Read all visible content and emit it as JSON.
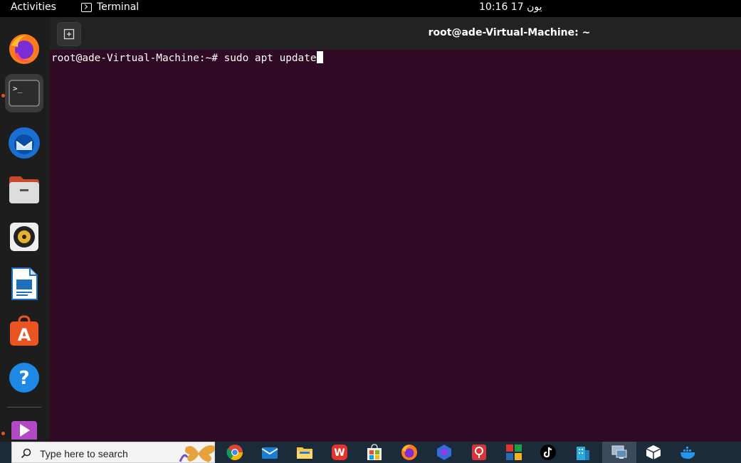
{
  "topbar": {
    "activities": "Activities",
    "app_name": "Terminal",
    "clock": "10:16  يون 17"
  },
  "dock": {
    "items": [
      "firefox-icon",
      "terminal-icon",
      "thunderbird-icon",
      "files-icon",
      "rhythmbox-icon",
      "libreoffice-writer-icon",
      "ubuntu-software-icon",
      "help-icon",
      "media-player-icon"
    ],
    "active": "terminal-icon"
  },
  "terminal": {
    "title": "root@ade-Virtual-Machine: ~",
    "prompt": "root@ade-Virtual-Machine:~# ",
    "command": "sudo apt update"
  },
  "taskbar": {
    "search_placeholder": "Type here to search",
    "icons": [
      "chrome-icon",
      "mail-icon",
      "file-explorer-icon",
      "wps-office-icon",
      "microsoft-store-icon",
      "firefox-icon",
      "copilot-icon",
      "presentation-icon",
      "zoho-icon",
      "tiktok-icon",
      "building-app-icon",
      "remote-desktop-icon",
      "package-box-icon",
      "docker-icon"
    ]
  },
  "colors": {
    "terminal_bg": "#300a24",
    "dock_bg": "#1d1d1d",
    "accent": "#e95420",
    "taskbar_bg": "#1c2b3a"
  }
}
